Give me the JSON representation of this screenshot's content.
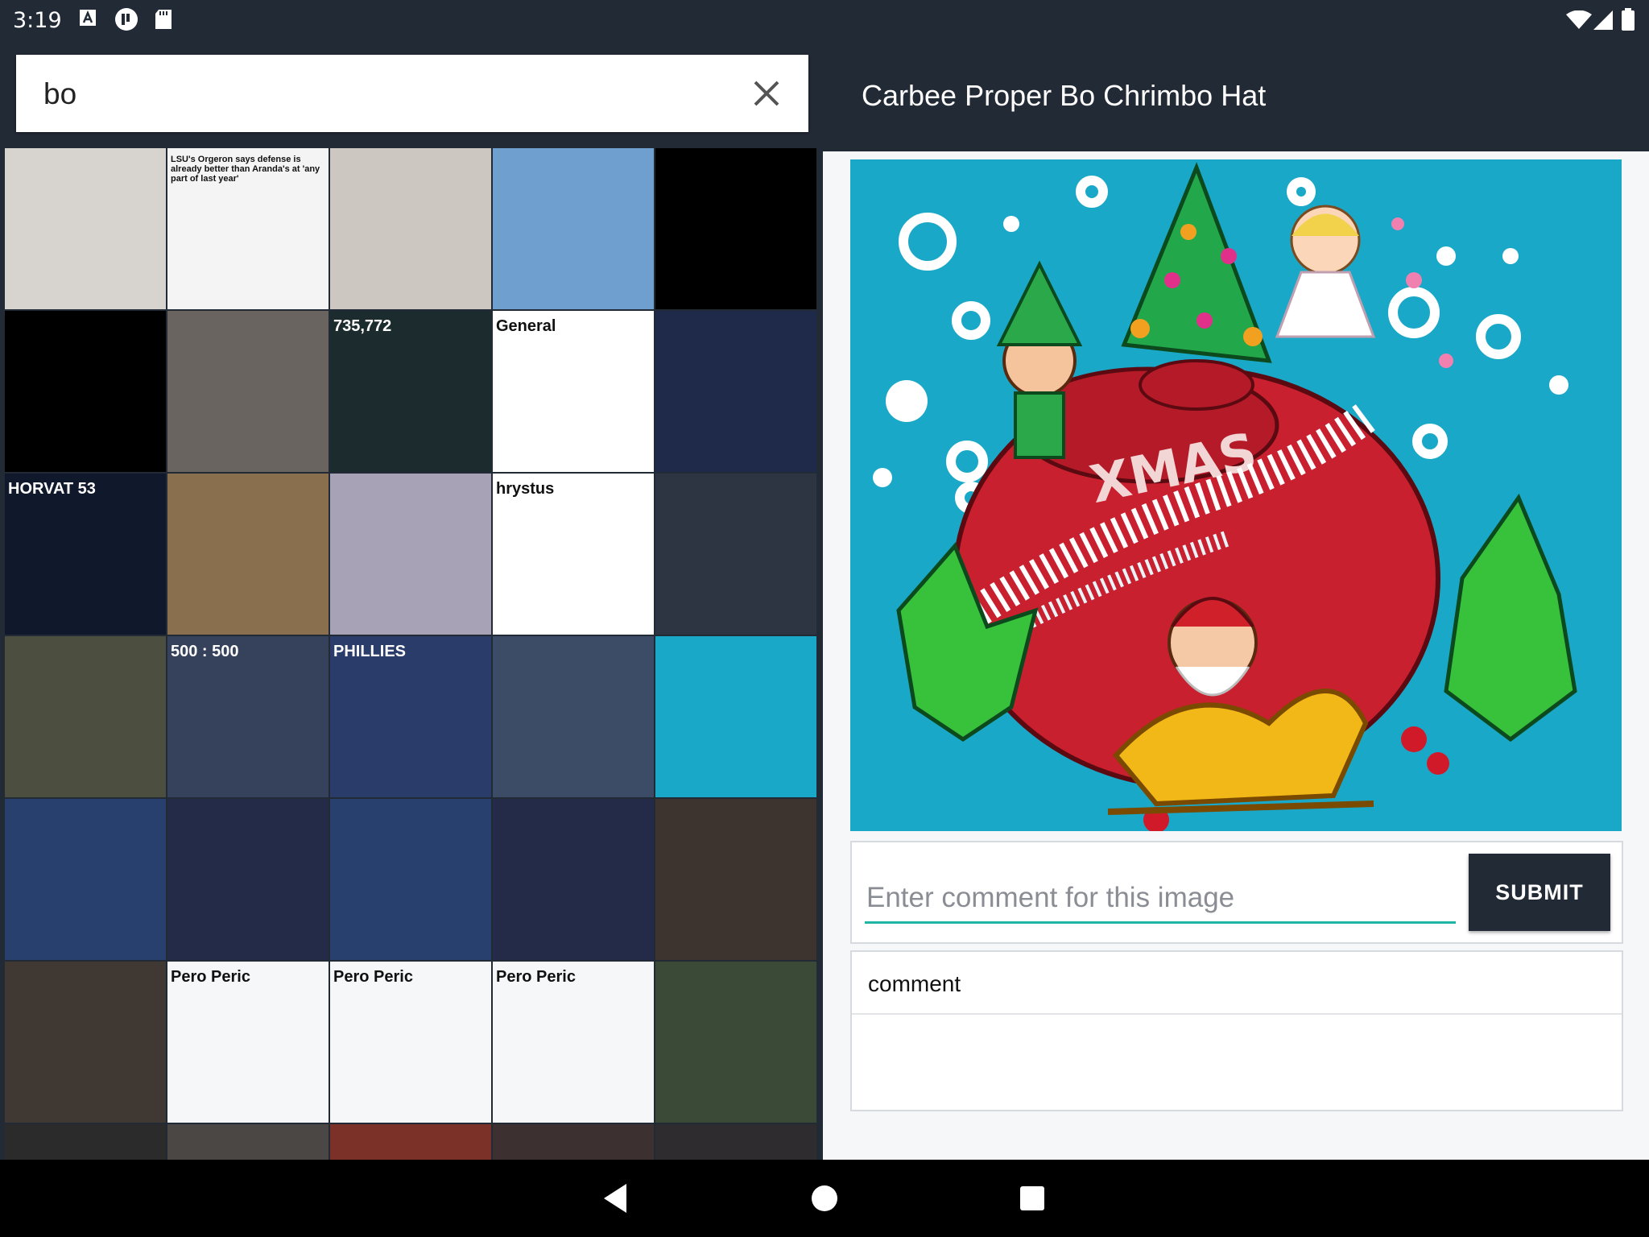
{
  "status_bar": {
    "time": "3:19"
  },
  "search": {
    "value": "bo",
    "placeholder": ""
  },
  "grid": {
    "tiles": [
      {
        "name": "man-white-shirt",
        "bg": "#d7d4cf",
        "caption": ""
      },
      {
        "name": "lsu-news",
        "bg": "#f4f4f4",
        "caption": "LSU's Orgeron says defense is already better than Aranda's at 'any part of last year'"
      },
      {
        "name": "man-red-nose",
        "bg": "#ccc7c0",
        "caption": ""
      },
      {
        "name": "landscape",
        "bg": "#6f9fcf",
        "caption": ""
      },
      {
        "name": "green-stick",
        "bg": "#000000",
        "caption": ""
      },
      {
        "name": "green-stick-2",
        "bg": "#000000",
        "caption": ""
      },
      {
        "name": "man-coat",
        "bg": "#6a6460",
        "caption": ""
      },
      {
        "name": "game-score",
        "bg": "#1c2b2e",
        "caption": "735,772"
      },
      {
        "name": "settings-table",
        "bg": "#ffffff",
        "caption": "General"
      },
      {
        "name": "jersey-50",
        "bg": "#1f2a4a",
        "caption": ""
      },
      {
        "name": "jersey-53",
        "bg": "#10182c",
        "caption": "HORVAT 53"
      },
      {
        "name": "man-guitar",
        "bg": "#8a6f4f",
        "caption": ""
      },
      {
        "name": "football-collage",
        "bg": "#a7a2b5",
        "caption": ""
      },
      {
        "name": "polish-text",
        "bg": "#ffffff",
        "caption": "hrystus"
      },
      {
        "name": "rookie-card",
        "bg": "#2e3542",
        "caption": ""
      },
      {
        "name": "signed-card",
        "bg": "#4c4e3f",
        "caption": ""
      },
      {
        "name": "game-500",
        "bg": "#36425c",
        "caption": "500 : 500"
      },
      {
        "name": "phillies-cards",
        "bg": "#2a3c6a",
        "caption": "PHILLIES"
      },
      {
        "name": "mandalorian",
        "bg": "#3c4b66",
        "caption": ""
      },
      {
        "name": "xmas-thumb",
        "bg": "#1aa8c8",
        "caption": ""
      },
      {
        "name": "cards-binder-1",
        "bg": "#28406e",
        "caption": ""
      },
      {
        "name": "cards-binder-2",
        "bg": "#242b48",
        "caption": ""
      },
      {
        "name": "cards-binder-3",
        "bg": "#28406e",
        "caption": ""
      },
      {
        "name": "cards-binder-4",
        "bg": "#242b48",
        "caption": ""
      },
      {
        "name": "cards-table",
        "bg": "#3d342f",
        "caption": ""
      },
      {
        "name": "dog",
        "bg": "#3f3833",
        "caption": ""
      },
      {
        "name": "social-post-1",
        "bg": "#f6f7f8",
        "caption": "Pero Peric"
      },
      {
        "name": "social-post-2",
        "bg": "#f6f7f8",
        "caption": "Pero Peric"
      },
      {
        "name": "social-post-3",
        "bg": "#f6f7f8",
        "caption": "Pero Peric"
      },
      {
        "name": "football-card",
        "bg": "#3b4a36",
        "caption": ""
      },
      {
        "name": "partial-1",
        "bg": "#2b2b2b",
        "caption": ""
      },
      {
        "name": "partial-2",
        "bg": "#4b4744",
        "caption": ""
      },
      {
        "name": "partial-3",
        "bg": "#7b3028",
        "caption": ""
      },
      {
        "name": "partial-4",
        "bg": "#3c3030",
        "caption": ""
      },
      {
        "name": "partial-5",
        "bg": "#2f2c30",
        "caption": ""
      }
    ]
  },
  "detail": {
    "title": "Carbee Proper Bo Chrimbo Hat",
    "comment_placeholder": "Enter comment for this image",
    "submit_label": "SUBMIT",
    "comments": [
      "comment"
    ]
  },
  "colors": {
    "accent": "#1fb5a5",
    "header_bg": "#222a35",
    "hero_bg": "#1aa8c8"
  }
}
